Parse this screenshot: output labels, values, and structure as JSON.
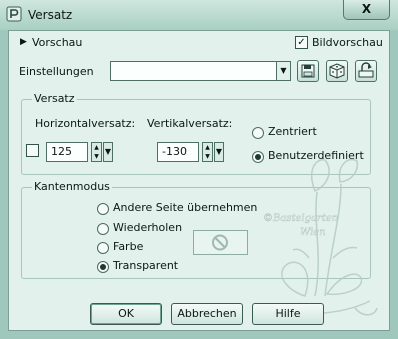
{
  "window": {
    "title": "Versatz",
    "close_glyph": "X"
  },
  "preview": {
    "label": "Vorschau",
    "image_preview_label": "Bildvorschau",
    "image_preview_checked": true
  },
  "settings": {
    "label": "Einstellungen",
    "value": ""
  },
  "offset_group": {
    "title": "Versatz",
    "horizontal": {
      "label": "Horizontalversatz:",
      "value": "125"
    },
    "vertical": {
      "label": "Vertikalversatz:",
      "value": "-130"
    },
    "centered_label": "Zentriert",
    "custom_label": "Benutzerdefiniert",
    "selected": "custom"
  },
  "edge_group": {
    "title": "Kantenmodus",
    "options": [
      {
        "label": "Andere Seite übernehmen",
        "checked": false
      },
      {
        "label": "Wiederholen",
        "checked": false
      },
      {
        "label": "Farbe",
        "checked": false
      },
      {
        "label": "Transparent",
        "checked": true
      }
    ]
  },
  "watermark": {
    "line1": "©Bastelgarten",
    "line2": "Wien"
  },
  "buttons": {
    "ok": "OK",
    "cancel": "Abbrechen",
    "help": "Hilfe"
  },
  "colors": {
    "title_bar": "#b7d9ce",
    "dialog_bg": "#e2f1ec",
    "text": "#0c1714"
  }
}
